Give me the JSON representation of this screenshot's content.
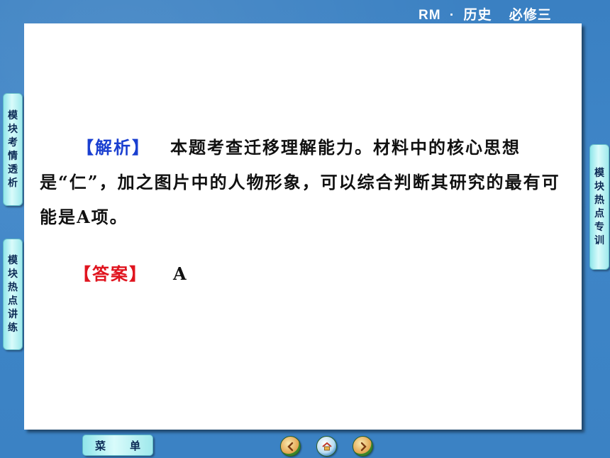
{
  "header": {
    "brand": "RM",
    "separator": "·",
    "subject": "历史",
    "volume": "必修三"
  },
  "left_tabs": [
    {
      "chars": [
        "模",
        "块",
        "考",
        "情",
        "透",
        "析"
      ]
    },
    {
      "chars": [
        "模",
        "块",
        "热",
        "点",
        "讲",
        "练"
      ]
    }
  ],
  "right_tabs": [
    {
      "chars": [
        "模",
        "块",
        "热",
        "点",
        "专",
        "训"
      ]
    }
  ],
  "content": {
    "analysis_tag": "【解析】",
    "analysis_text": "本题考查迁移理解能力。材料中的核心思想是“仁”，加之图片中的人物形象，可以综合判断其研究的最有可能是A项。",
    "answer_tag": "【答案】",
    "answer_value": "A"
  },
  "footer": {
    "menu_chars": [
      "菜",
      "单"
    ],
    "nav": [
      "prev-icon",
      "home-icon",
      "next-icon"
    ]
  }
}
